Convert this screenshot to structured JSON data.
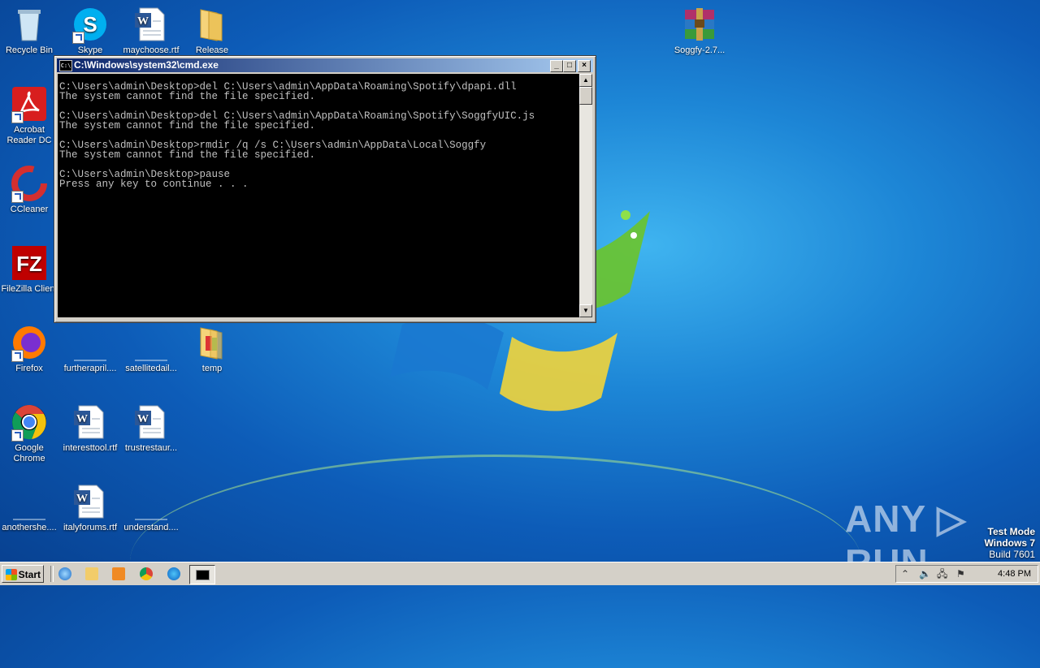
{
  "desktop": {
    "icons": [
      {
        "id": "recycle-bin",
        "label": "Recycle Bin",
        "icon": "recycle-bin-icon",
        "shortcut": false
      },
      {
        "id": "skype",
        "label": "Skype",
        "icon": "skype-icon",
        "shortcut": true
      },
      {
        "id": "maychoose",
        "label": "maychoose.rtf",
        "icon": "word-doc-icon",
        "shortcut": false
      },
      {
        "id": "release",
        "label": "Release",
        "icon": "folder-icon",
        "shortcut": false
      },
      {
        "id": "soggfy",
        "label": "Soggfy-2.7...",
        "icon": "winrar-archive-icon",
        "shortcut": false
      },
      {
        "id": "acrobat",
        "label": "Acrobat Reader DC",
        "icon": "acrobat-icon",
        "shortcut": true
      },
      {
        "id": "ccleaner",
        "label": "CCleaner",
        "icon": "ccleaner-icon",
        "shortcut": true
      },
      {
        "id": "filezilla",
        "label": "FileZilla Client",
        "icon": "filezilla-icon",
        "shortcut": true
      },
      {
        "id": "firefox",
        "label": "Firefox",
        "icon": "firefox-icon",
        "shortcut": true
      },
      {
        "id": "furtherapril",
        "label": "furtherapril....",
        "icon": "blank-file-icon",
        "shortcut": false
      },
      {
        "id": "satellitedail",
        "label": "satellitedail...",
        "icon": "blank-file-icon",
        "shortcut": false
      },
      {
        "id": "temp",
        "label": "temp",
        "icon": "folder-icon",
        "shortcut": false
      },
      {
        "id": "chrome",
        "label": "Google Chrome",
        "icon": "chrome-icon",
        "shortcut": true
      },
      {
        "id": "interesttool",
        "label": "interesttool.rtf",
        "icon": "word-doc-icon",
        "shortcut": false
      },
      {
        "id": "trustrestaur",
        "label": "trustrestaur...",
        "icon": "word-doc-icon",
        "shortcut": false
      },
      {
        "id": "anothershe",
        "label": "anothershe....",
        "icon": "blank-file-icon",
        "shortcut": false
      },
      {
        "id": "italyforums",
        "label": "italyforums.rtf",
        "icon": "word-doc-icon",
        "shortcut": false
      },
      {
        "id": "understand",
        "label": "understand....",
        "icon": "blank-file-icon",
        "shortcut": false
      }
    ]
  },
  "cmd": {
    "title": "C:\\Windows\\system32\\cmd.exe",
    "app_icon_text": "C:\\",
    "minimize": "_",
    "maximize": "□",
    "close": "×",
    "output": "C:\\Users\\admin\\Desktop>del C:\\Users\\admin\\AppData\\Roaming\\Spotify\\dpapi.dll\nThe system cannot find the file specified.\n\nC:\\Users\\admin\\Desktop>del C:\\Users\\admin\\AppData\\Roaming\\Spotify\\SoggfyUIC.js\nThe system cannot find the file specified.\n\nC:\\Users\\admin\\Desktop>rmdir /q /s C:\\Users\\admin\\AppData\\Local\\Soggfy\nThe system cannot find the file specified.\n\nC:\\Users\\admin\\Desktop>pause\nPress any key to continue . . .",
    "scroll_up": "▲",
    "scroll_down": "▼"
  },
  "watermark": {
    "text": "ANY ▷ RUN"
  },
  "os_notice": {
    "line1": "Test Mode",
    "line2": "Windows 7",
    "line3": "Build 7601"
  },
  "taskbar": {
    "start_label": "Start",
    "clock": "4:48 PM",
    "tray_icons": {
      "chevron": "⌃",
      "speaker": "🔈",
      "network": "🖧",
      "flag": "⚑"
    }
  },
  "colors": {
    "cmd_text": "#c0c0c0",
    "cmd_bg": "#000000",
    "title_start": "#0a246a",
    "title_end": "#a6caf0"
  }
}
